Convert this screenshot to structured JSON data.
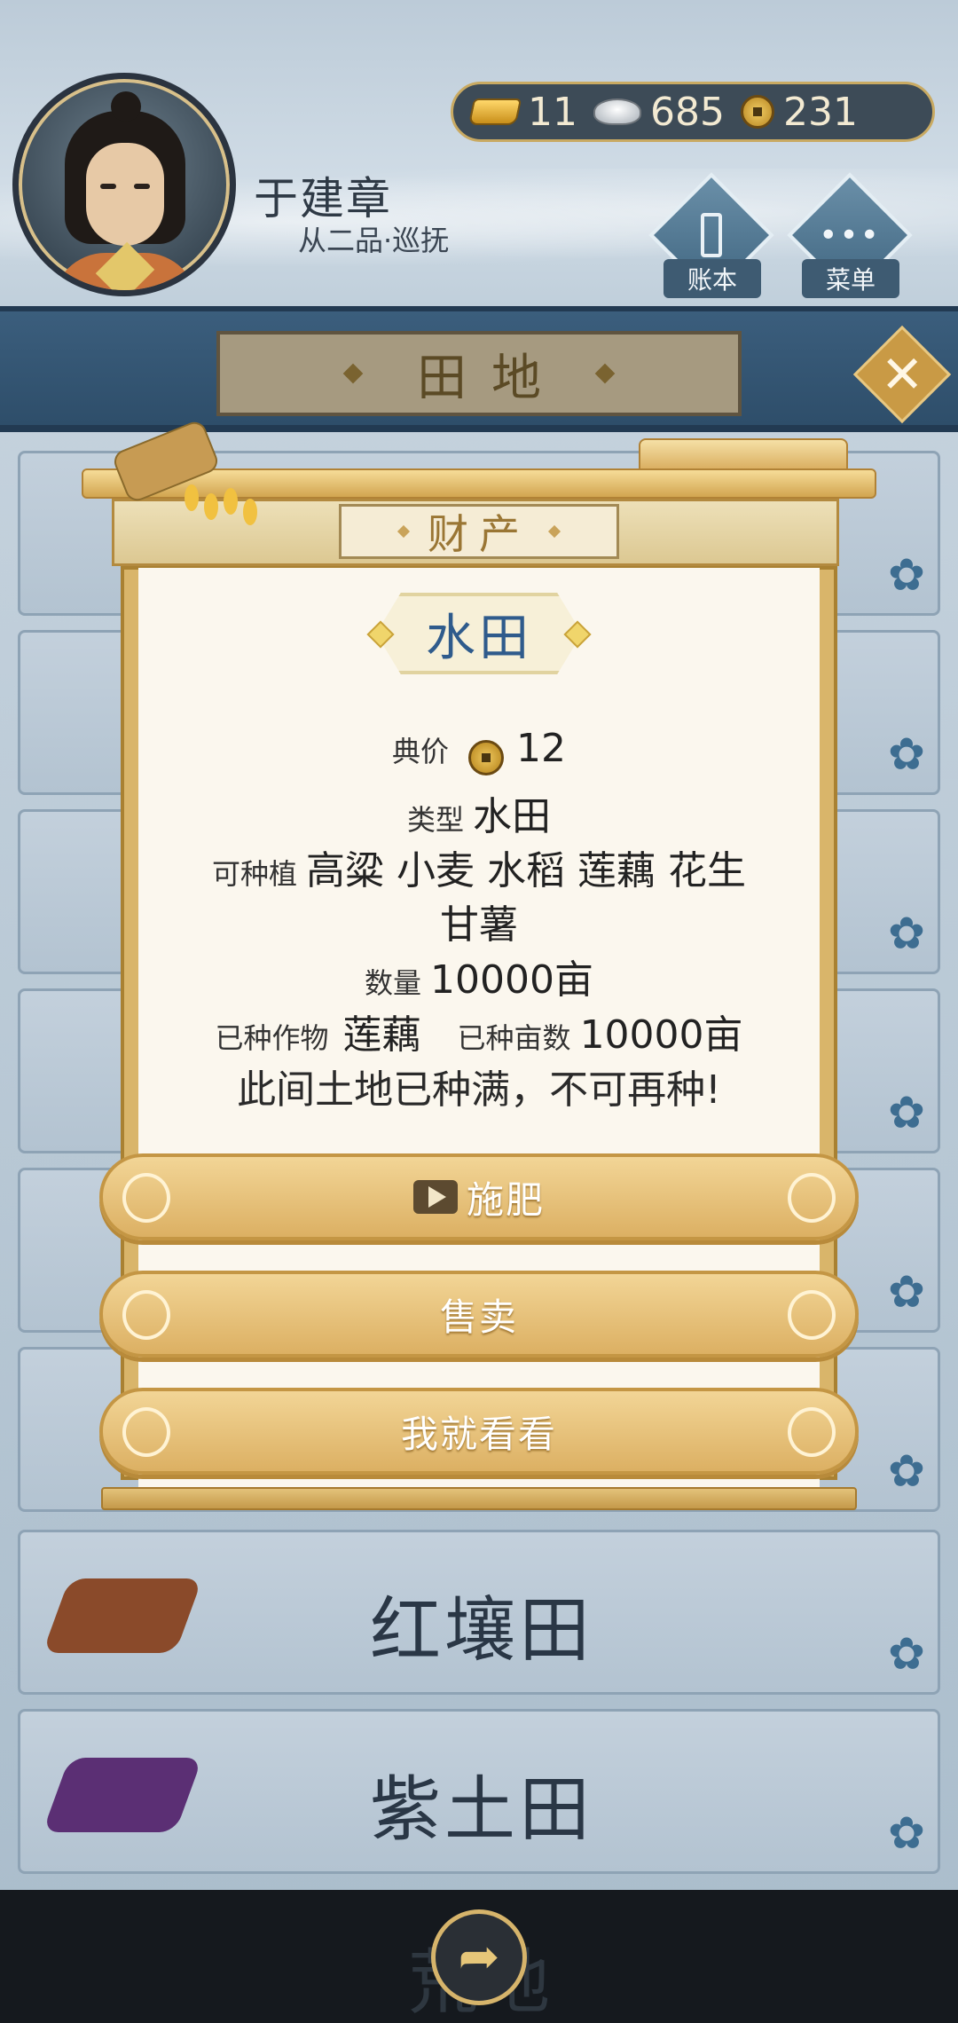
{
  "header": {
    "player_name": "于建章",
    "player_rank": "从二品·巡抚",
    "currency": {
      "gold": "11",
      "silver": "685",
      "copper": "231"
    },
    "ledger_label": "账本",
    "menu_label": "菜单"
  },
  "page_title": "田地",
  "close_icon": "✕",
  "background_fields": [
    {
      "name": "红壤田",
      "soil_color": "#8a4a2a"
    },
    {
      "name": "紫土田",
      "soil_color": "#5b2f74"
    },
    {
      "name": "荒地",
      "soil_color": "#3a3a2a"
    }
  ],
  "modal": {
    "header_title": "财产",
    "land_name": "水田",
    "price_label": "典价",
    "price_value": "12",
    "type_label": "类型",
    "type_value": "水田",
    "plantable_label": "可种植",
    "plantable_line1": "高粱 小麦 水稻 莲藕 花生",
    "plantable_line2": "甘薯",
    "quantity_label": "数量",
    "quantity_value": "10000亩",
    "planted_crop_label": "已种作物",
    "planted_crop_value": "莲藕",
    "planted_area_label": "已种亩数",
    "planted_area_value": "10000亩",
    "full_message": "此间土地已种满，不可再种!",
    "buttons": {
      "fertilize": "施肥",
      "sell": "售卖",
      "browse": "我就看看"
    }
  },
  "colors": {
    "accent_gold": "#dcb063",
    "title_blue": "#2f5b8c",
    "band_blue": "#2e4e6a"
  }
}
